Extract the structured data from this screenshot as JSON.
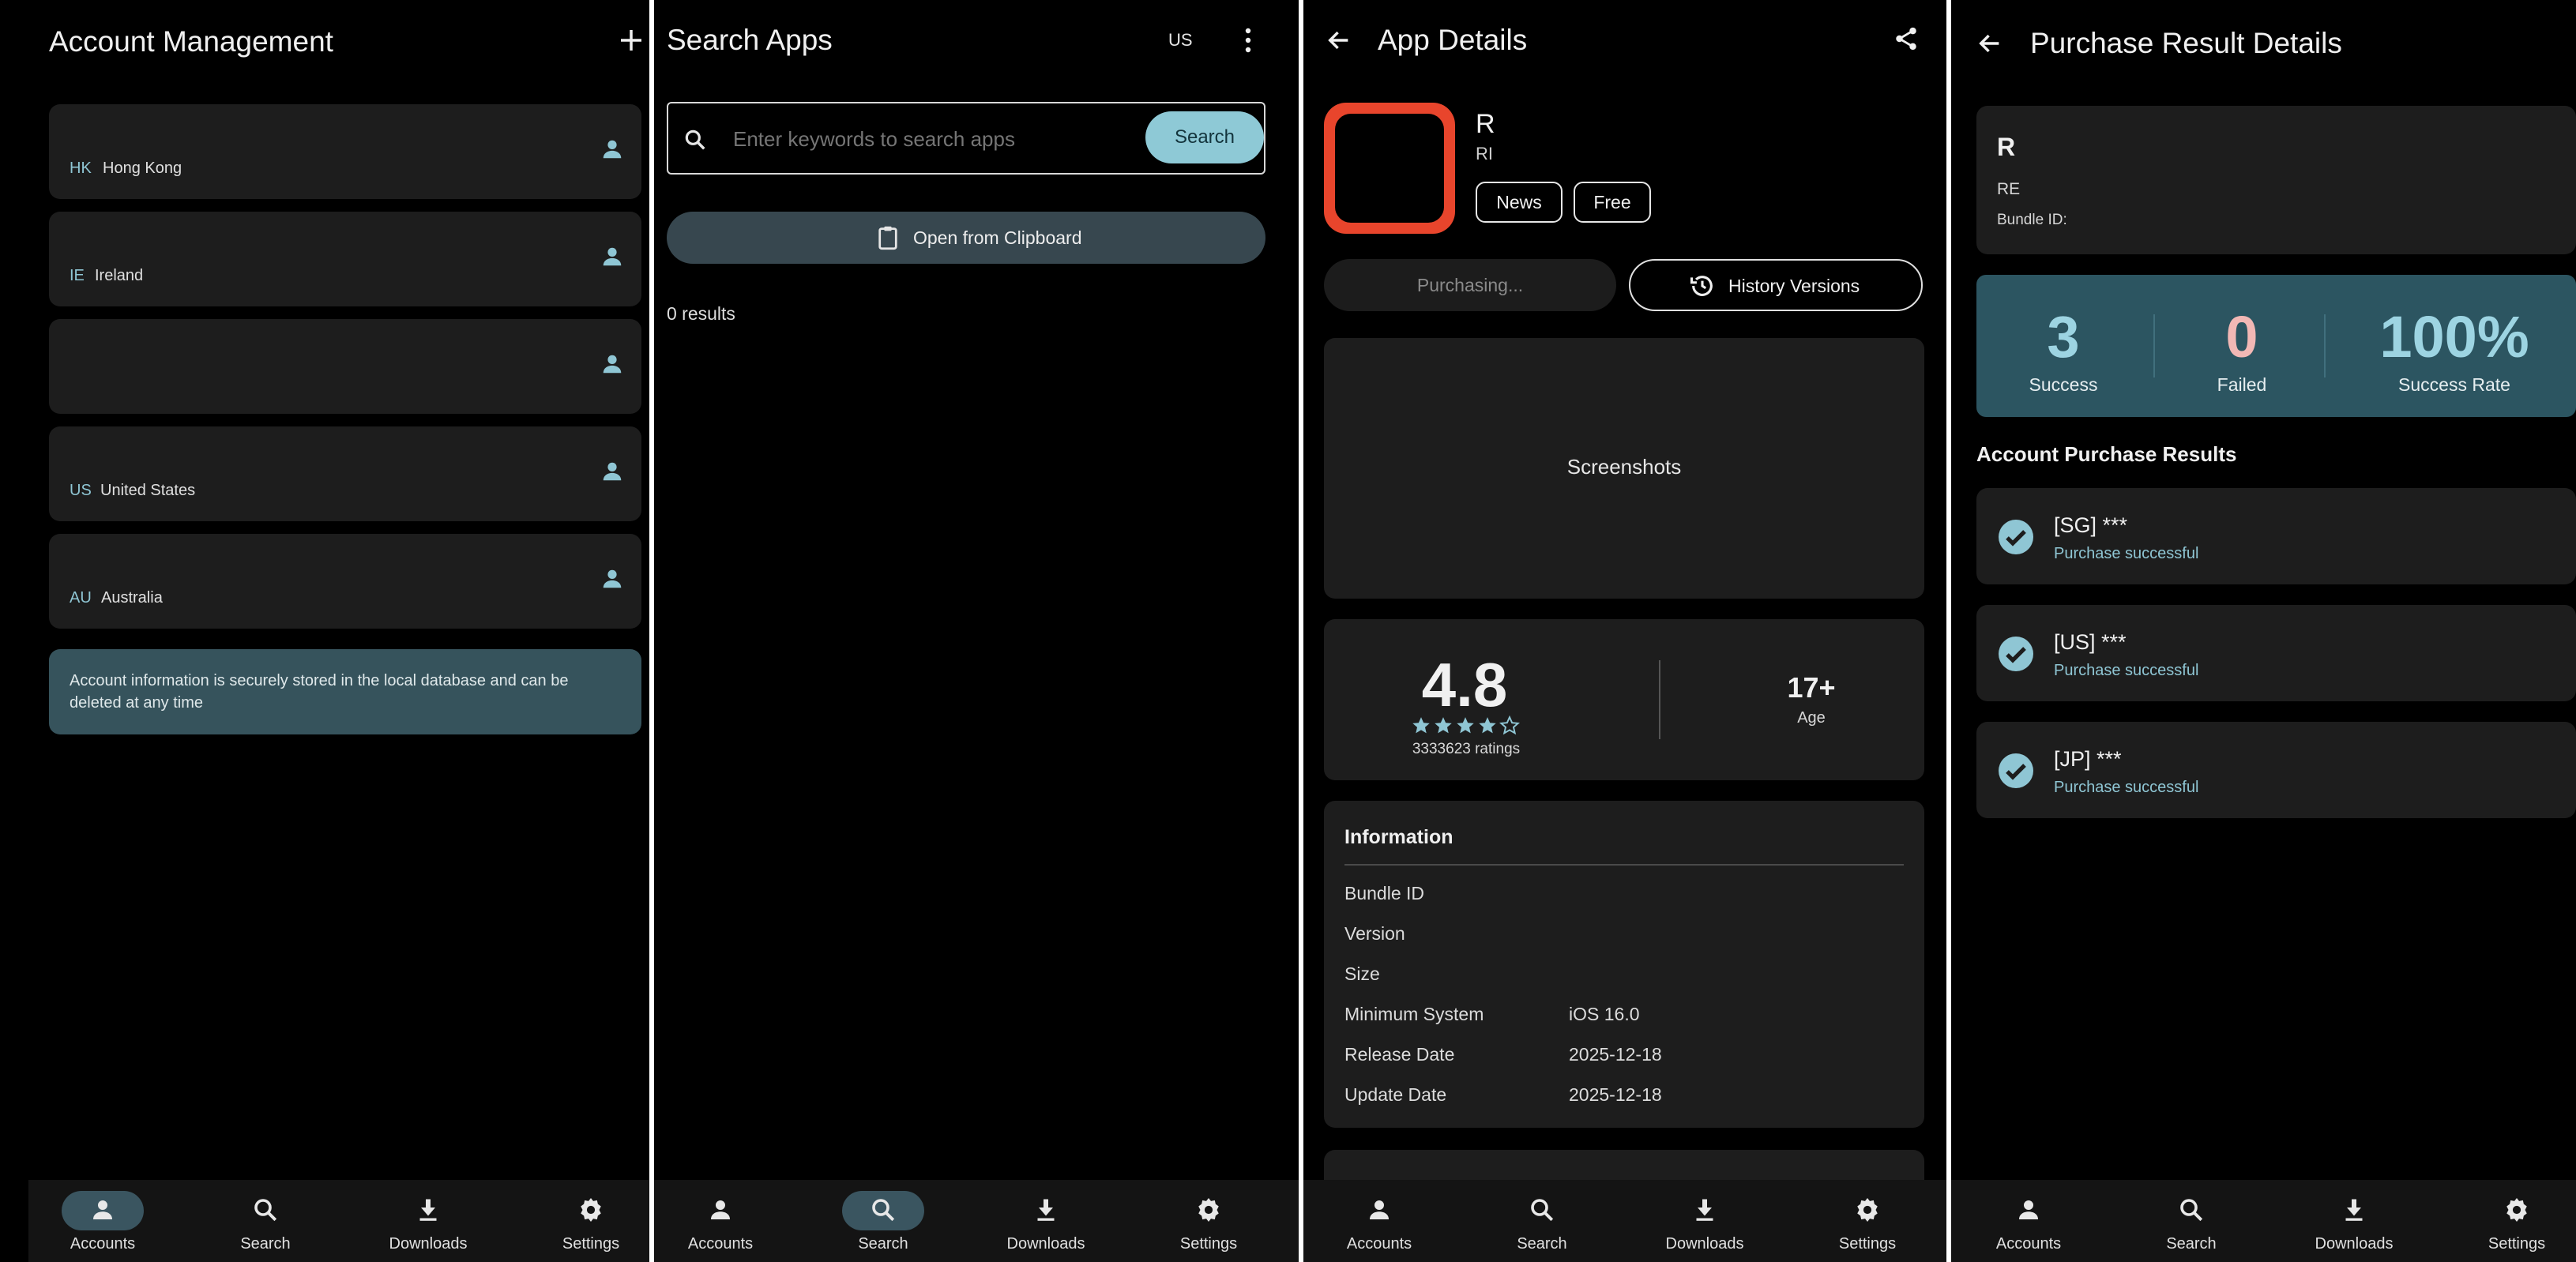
{
  "accounts": {
    "title": "Account Management",
    "items": [
      {
        "code": "HK",
        "name": "Hong Kong"
      },
      {
        "code": "IE",
        "name": "Ireland"
      },
      {
        "code": "",
        "name": ""
      },
      {
        "code": "US",
        "name": "United States"
      },
      {
        "code": "AU",
        "name": "Australia"
      }
    ],
    "notice": "Account information is securely stored in the local database and can be deleted at any time"
  },
  "search": {
    "title": "Search Apps",
    "region": "US",
    "placeholder": "Enter keywords to search apps",
    "search_button": "Search",
    "clipboard_button": "Open from Clipboard",
    "results": "0 results"
  },
  "details": {
    "title": "App Details",
    "app_name": "R",
    "app_sub": "RI",
    "tag_category": "News",
    "tag_price": "Free",
    "purchasing": "Purchasing...",
    "history": "History Versions",
    "screenshots": "Screenshots",
    "rating": "4.8",
    "rating_stars": 4,
    "ratings_count": "3333623 ratings",
    "age": "17+",
    "age_label": "Age",
    "info_title": "Information",
    "info": [
      {
        "label": "Bundle ID",
        "value": ""
      },
      {
        "label": "Version",
        "value": ""
      },
      {
        "label": "Size",
        "value": ""
      },
      {
        "label": "Minimum System",
        "value": "iOS 16.0"
      },
      {
        "label": "Release Date",
        "value": "2025-12-18"
      },
      {
        "label": "Update Date",
        "value": "2025-12-18"
      }
    ]
  },
  "result": {
    "title": "Purchase Result Details",
    "app_name": "R",
    "app_sub": "RE",
    "bundle_label": "Bundle ID:",
    "stats": [
      {
        "value": "3",
        "label": "Success",
        "color": "#9dd4e2"
      },
      {
        "value": "0",
        "label": "Failed",
        "color": "#f2b8b5"
      },
      {
        "value": "100%",
        "label": "Success Rate",
        "color": "#9dd4e2"
      }
    ],
    "section_title": "Account Purchase Results",
    "items": [
      {
        "account": "[SG] ***",
        "status": "Purchase successful"
      },
      {
        "account": "[US] ***",
        "status": "Purchase successful"
      },
      {
        "account": "[JP] ***",
        "status": "Purchase successful"
      }
    ]
  },
  "nav": {
    "accounts": "Accounts",
    "search": "Search",
    "downloads": "Downloads",
    "settings": "Settings"
  },
  "colors": {
    "accent": "#8fc6d4",
    "accent_dark": "#3a5560",
    "card": "#1d1d1d",
    "icon_frame": "#e8452c"
  }
}
